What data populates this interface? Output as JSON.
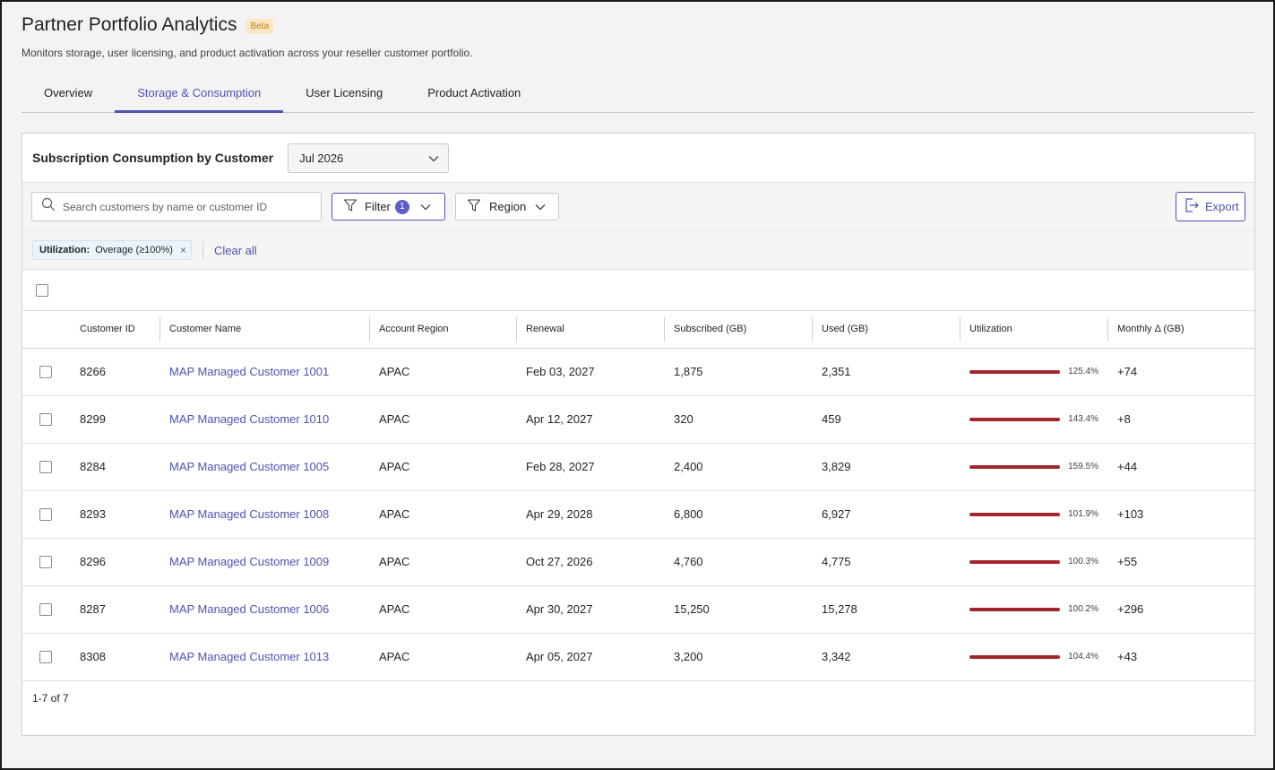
{
  "app": {
    "title": "Partner Portfolio Analytics",
    "badge": "Beta",
    "subtitle": "Monitors storage, user licensing, and product activation across your reseller customer portfolio."
  },
  "tabs": [
    {
      "label": "Overview",
      "active": false
    },
    {
      "label": "Storage & Consumption",
      "active": true
    },
    {
      "label": "User Licensing",
      "active": false
    },
    {
      "label": "Product Activation",
      "active": false
    }
  ],
  "panel": {
    "title": "Subscription Consumption by Customer",
    "month": "Jul 2026"
  },
  "toolbar": {
    "search_placeholder": "Search customers by name or customer ID",
    "filter_label": "Filter",
    "filter_count": "1",
    "region_label": "Region",
    "export_label": "Export"
  },
  "chips": {
    "chip_key": "Utilization:",
    "chip_value": "Overage (≥100%)",
    "remove_glyph": "×",
    "clear_all": "Clear all"
  },
  "table": {
    "columns": [
      "Customer ID",
      "Customer Name",
      "Account Region",
      "Renewal",
      "Subscribed (GB)",
      "Used (GB)",
      "Utilization",
      "Monthly Δ (GB)"
    ],
    "rows": [
      {
        "id": "8266",
        "name": "MAP Managed Customer 1001",
        "region": "APAC",
        "renewal": "Feb 03, 2027",
        "subscribed": "1,875",
        "used": "2,351",
        "utilization": "125.4%",
        "delta": "+74"
      },
      {
        "id": "8299",
        "name": "MAP Managed Customer 1010",
        "region": "APAC",
        "renewal": "Apr 12, 2027",
        "subscribed": "320",
        "used": "459",
        "utilization": "143.4%",
        "delta": "+8"
      },
      {
        "id": "8284",
        "name": "MAP Managed Customer 1005",
        "region": "APAC",
        "renewal": "Feb 28, 2027",
        "subscribed": "2,400",
        "used": "3,829",
        "utilization": "159.5%",
        "delta": "+44"
      },
      {
        "id": "8293",
        "name": "MAP Managed Customer 1008",
        "region": "APAC",
        "renewal": "Apr 29, 2028",
        "subscribed": "6,800",
        "used": "6,927",
        "utilization": "101.9%",
        "delta": "+103"
      },
      {
        "id": "8296",
        "name": "MAP Managed Customer 1009",
        "region": "APAC",
        "renewal": "Oct 27, 2026",
        "subscribed": "4,760",
        "used": "4,775",
        "utilization": "100.3%",
        "delta": "+55"
      },
      {
        "id": "8287",
        "name": "MAP Managed Customer 1006",
        "region": "APAC",
        "renewal": "Apr 30, 2027",
        "subscribed": "15,250",
        "used": "15,278",
        "utilization": "100.2%",
        "delta": "+296"
      },
      {
        "id": "8308",
        "name": "MAP Managed Customer 1013",
        "region": "APAC",
        "renewal": "Apr 05, 2027",
        "subscribed": "3,200",
        "used": "3,342",
        "utilization": "104.4%",
        "delta": "+43"
      }
    ]
  },
  "pagination": "1-7 of 7",
  "colors": {
    "accent": "#4f52b2",
    "overage_bar": "#a4262c",
    "badge_bg": "#fbe7c6"
  }
}
